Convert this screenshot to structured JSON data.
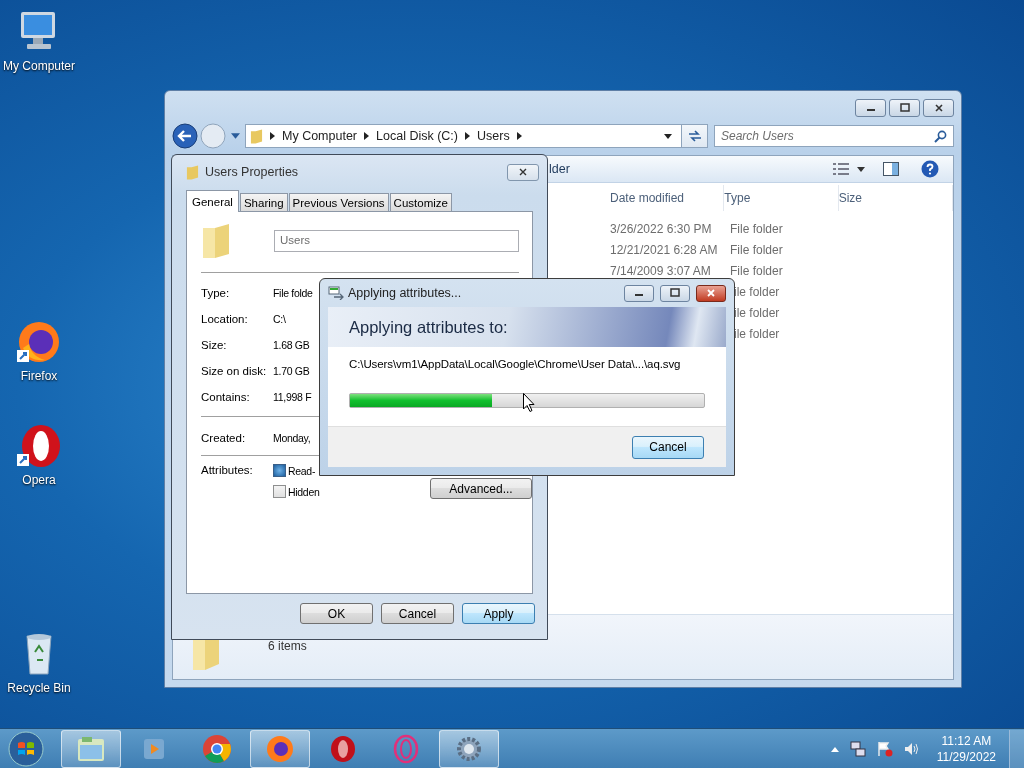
{
  "desktop_icons": [
    {
      "label": "My Computer",
      "kind": "computer"
    },
    {
      "label": "Firefox",
      "kind": "firefox"
    },
    {
      "label": "Opera",
      "kind": "opera"
    },
    {
      "label": "Recycle Bin",
      "kind": "bin"
    }
  ],
  "explorer": {
    "breadcrumb": [
      "My Computer",
      "Local Disk (C:)",
      "Users"
    ],
    "search": {
      "placeholder": "Search Users"
    },
    "toolbar_text": "lder",
    "columns": [
      "Date modified",
      "Type",
      "Size"
    ],
    "rows": [
      {
        "date": "3/26/2022 6:30 PM",
        "type": "File folder"
      },
      {
        "date": "12/21/2021 6:28 AM",
        "type": "File folder"
      },
      {
        "date": "7/14/2009 3:07 AM",
        "type": "File folder"
      },
      {
        "type": "ile folder"
      },
      {
        "type": "ile folder"
      },
      {
        "type": "ile folder"
      }
    ],
    "status": "6 items"
  },
  "properties": {
    "title": "Users Properties",
    "tabs": [
      {
        "label": "General",
        "selected": true
      },
      {
        "label": "Sharing",
        "selected": false
      },
      {
        "label": "Previous Versions",
        "selected": false
      },
      {
        "label": "Customize",
        "selected": false
      }
    ],
    "name_value": "Users",
    "details": [
      {
        "label": "Type:",
        "value": "File folde"
      },
      {
        "label": "Location:",
        "value": "C:\\"
      },
      {
        "label": "Size:",
        "value": "1.68 GB"
      },
      {
        "label": "Size on disk:",
        "value": "1.70 GB"
      },
      {
        "label": "Contains:",
        "value": "11,998 F"
      }
    ],
    "created": {
      "label": "Created:",
      "value": "Monday,"
    },
    "attributes_label": "Attributes:",
    "attributes": [
      {
        "label": "Read-",
        "checked": true
      },
      {
        "label": "Hidden",
        "checked": false
      }
    ],
    "advanced_button": "Advanced...",
    "buttons": [
      {
        "label": "OK",
        "default": false
      },
      {
        "label": "Cancel",
        "default": false
      },
      {
        "label": "Apply",
        "default": true
      }
    ]
  },
  "progress": {
    "title": "Applying attributes...",
    "heading": "Applying attributes to:",
    "path": "C:\\Users\\vm1\\AppData\\Local\\Google\\Chrome\\User Data\\...\\aq.svg",
    "level": 0.4,
    "cancel": "Cancel"
  },
  "taskbar": {
    "apps": [
      {
        "kind": "explorer",
        "running": true
      },
      {
        "kind": "media",
        "running": false
      },
      {
        "kind": "chrome",
        "running": false
      },
      {
        "kind": "firefox",
        "running": true
      },
      {
        "kind": "opera",
        "running": false
      },
      {
        "kind": "operagx",
        "running": false
      },
      {
        "kind": "gear",
        "running": true
      }
    ],
    "time": "11:12 AM",
    "date": "11/29/2022"
  }
}
